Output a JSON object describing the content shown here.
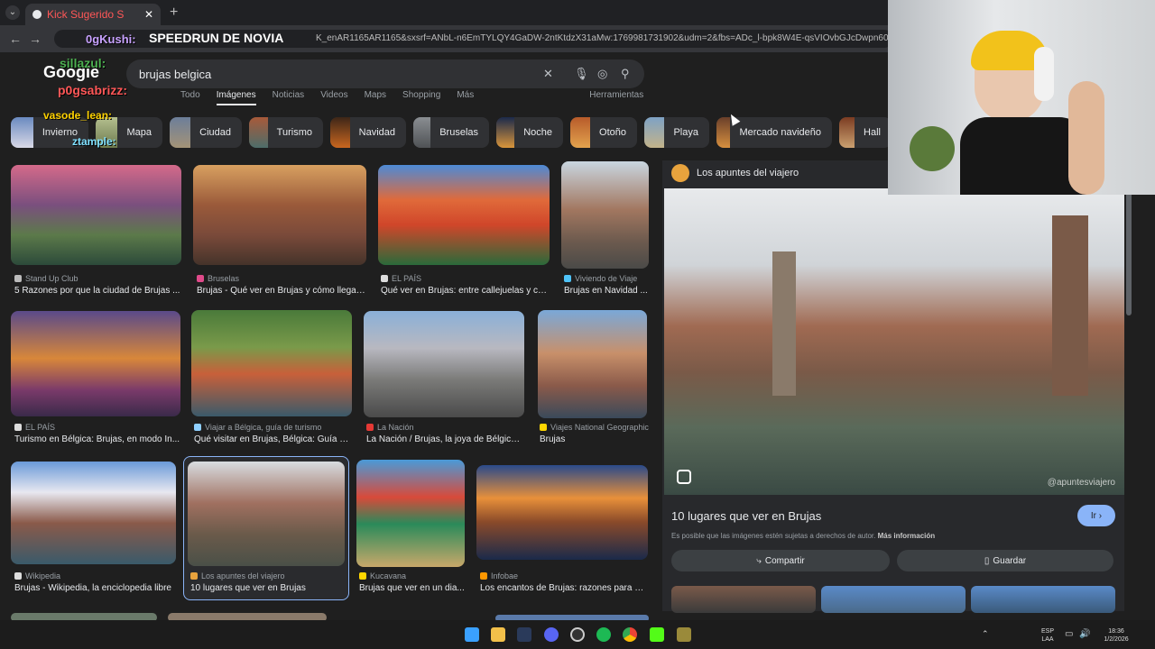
{
  "browser": {
    "tab_label": "Kick Sugerido S",
    "url_text": "K_enAR1165AR1165&sxsrf=ANbL-n6EmTYLQY4GaDW-2ntKtdzX31aMw:1769981731902&udm=2&fbs=ADc_l-bpk8W4E-qsVIOvbGJcDwpn60DczFdcvPnu",
    "back_icon": "back-arrow-icon",
    "forward_icon": "forward-arrow-icon"
  },
  "overlay": {
    "stream_title": "SPEEDRUN DE NOVIA",
    "chat_names": [
      "0gKushi:",
      "sillazul:",
      "p0gsabrizz:",
      "vasode_lean:",
      "ztample:"
    ]
  },
  "google": {
    "logo": "Google",
    "query": "brujas belgica",
    "filters": [
      "Todo",
      "Imágenes",
      "Noticias",
      "Videos",
      "Maps",
      "Shopping",
      "Más",
      "Herramientas"
    ],
    "active_filter": "Imágenes",
    "chips": [
      "Invierno",
      "Mapa",
      "Ciudad",
      "Turismo",
      "Navidad",
      "Bruselas",
      "Noche",
      "Otoño",
      "Playa",
      "Mercado navideño",
      "Hall"
    ]
  },
  "results": [
    {
      "source": "Stand Up Club",
      "title": "5 Razones por que la ciudad de Brujas ..."
    },
    {
      "source": "Bruselas",
      "title": "Brujas - Qué ver en Brujas y cómo llegar ..."
    },
    {
      "source": "EL PAÍS",
      "title": "Qué ver en Brujas: entre callejuelas y ca..."
    },
    {
      "source": "Viviendo de Viaje",
      "title": "Brujas en Navidad ..."
    },
    {
      "source": "EL PAÍS",
      "title": "Turismo en Bélgica: Brujas, en modo In..."
    },
    {
      "source": "Viajar a Bélgica, guía de turismo",
      "title": "Qué visitar en Brujas, Bélgica: Guía d..."
    },
    {
      "source": "La Nación",
      "title": "La Nación / Brujas, la joya de Bélgica,..."
    },
    {
      "source": "Viajes National Geographic",
      "title": "Brujas"
    },
    {
      "source": "Wikipedia",
      "title": "Brujas - Wikipedia, la enciclopedia libre"
    },
    {
      "source": "Los apuntes del viajero",
      "title": "10 lugares que ver en Brujas"
    },
    {
      "source": "Kucavana",
      "title": "Brujas que ver en un dia..."
    },
    {
      "source": "Infobae",
      "title": "Los encantos de Brujas: razones para vi..."
    }
  ],
  "panel": {
    "source": "Los apuntes del viajero",
    "title": "10 lugares que ver en Brujas",
    "go_label": "Ir",
    "note": "Es posible que las imágenes estén sujetas a derechos de autor.",
    "note_link": "Más información",
    "share_label": "Compartir",
    "save_label": "Guardar",
    "watermark": "@apuntesviajero"
  },
  "taskbar": {
    "lang": "ESP",
    "layout": "LAA",
    "time": "18:36",
    "date": "1/2/2026"
  }
}
